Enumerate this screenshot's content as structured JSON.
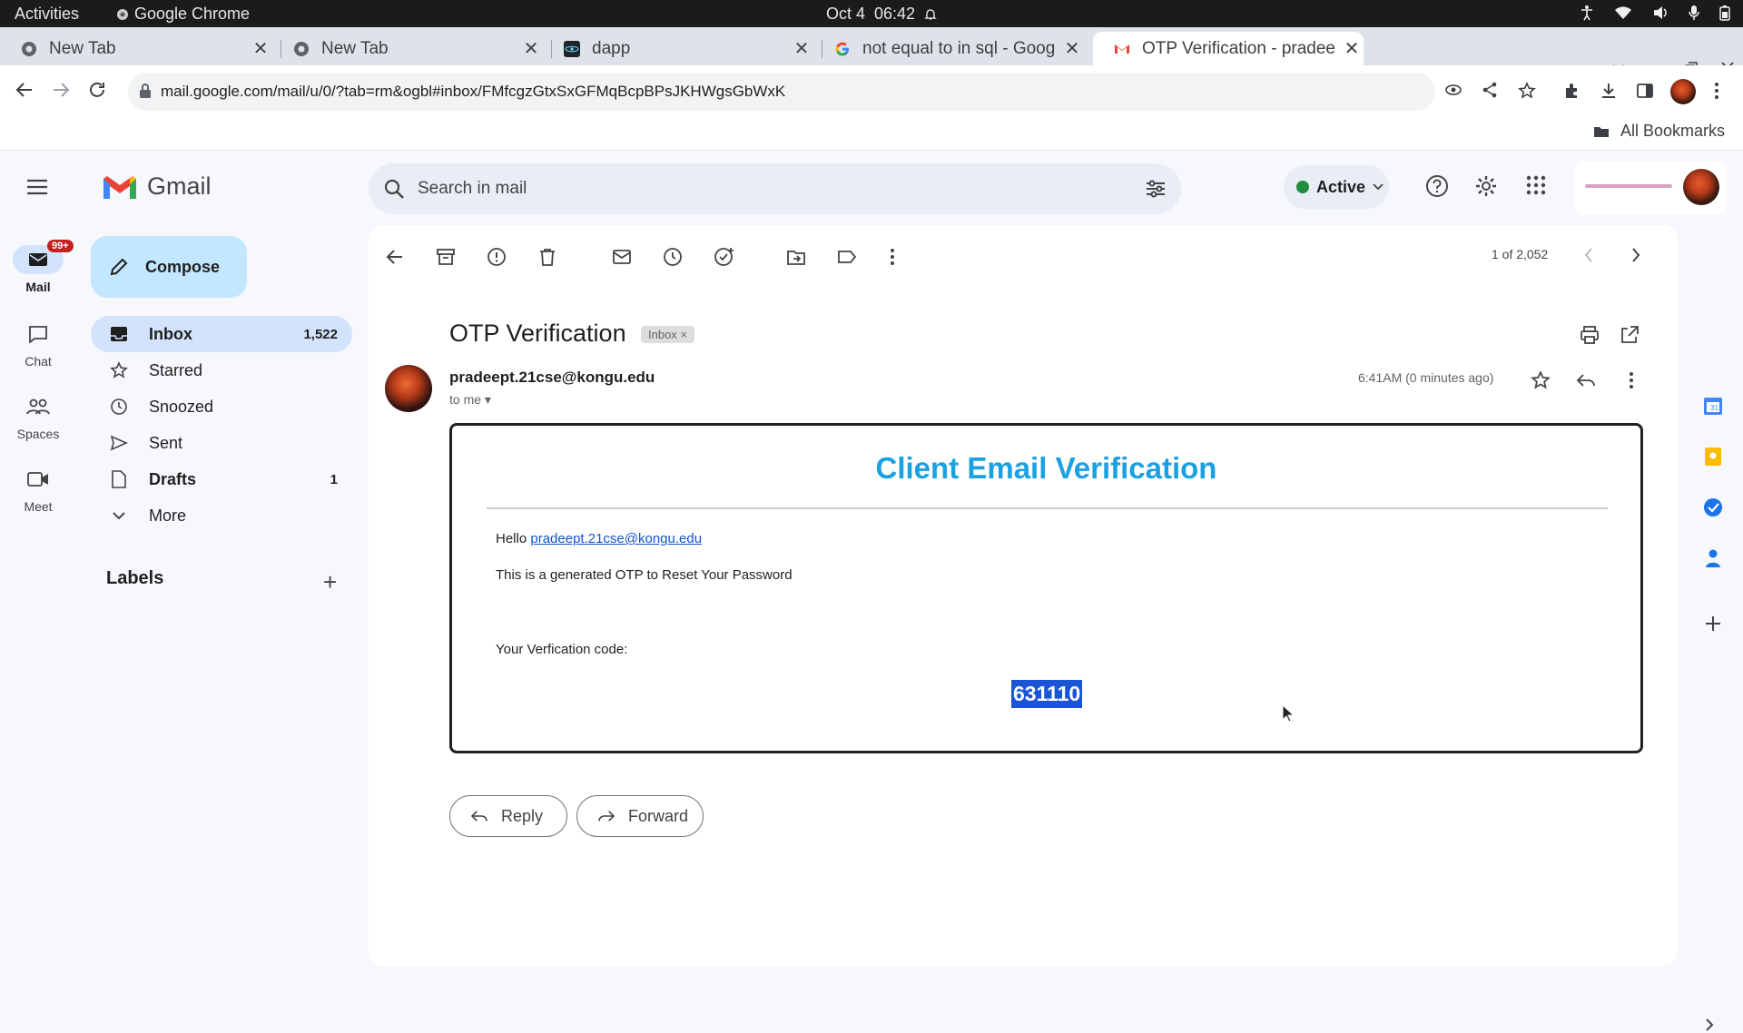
{
  "os": {
    "activities": "Activities",
    "app": "Google Chrome",
    "date": "Oct 4",
    "time": "06:42"
  },
  "tabs": [
    {
      "title": "New Tab",
      "icon": "chrome-icon"
    },
    {
      "title": "New Tab",
      "icon": "chrome-icon"
    },
    {
      "title": "dapp",
      "icon": "react-icon"
    },
    {
      "title": "not equal to in sql - Goog",
      "icon": "google-icon"
    },
    {
      "title": "OTP Verification - pradee",
      "icon": "gmail-icon",
      "active": true
    }
  ],
  "url": "mail.google.com/mail/u/0/?tab=rm&ogbl#inbox/FMfcgzGtxSxGFMqBcpBPsJKHWgsGbWxK",
  "bookmarks": {
    "all": "All Bookmarks"
  },
  "rail": [
    {
      "label": "Mail",
      "badge": "99+"
    },
    {
      "label": "Chat"
    },
    {
      "label": "Spaces"
    },
    {
      "label": "Meet"
    }
  ],
  "brand": "Gmail",
  "compose": "Compose",
  "nav": [
    {
      "label": "Inbox",
      "count": "1,522"
    },
    {
      "label": "Starred",
      "count": ""
    },
    {
      "label": "Snoozed",
      "count": ""
    },
    {
      "label": "Sent",
      "count": ""
    },
    {
      "label": "Drafts",
      "count": "1"
    },
    {
      "label": "More",
      "count": ""
    }
  ],
  "labels_title": "Labels",
  "search_placeholder": "Search in mail",
  "status": "Active",
  "pager": "1 of 2,052",
  "email": {
    "subject": "OTP Verification",
    "tag": "Inbox",
    "sender": "pradeept.21cse@kongu.edu",
    "to": "to me",
    "time": "6:41AM (0 minutes ago)",
    "heading": "Client Email Verification",
    "hello": "Hello",
    "hello_email": "pradeept.21cse@kongu.edu",
    "line2": "This is a generated OTP to Reset Your Password",
    "line3": "Your Verfication code:",
    "code": "631110"
  },
  "actions": {
    "reply": "Reply",
    "forward": "Forward"
  },
  "colors": {
    "accent": "#c2e7ff",
    "heading": "#1ba1e2",
    "selection": "#1a55d6",
    "status": "#1e8e3e"
  }
}
